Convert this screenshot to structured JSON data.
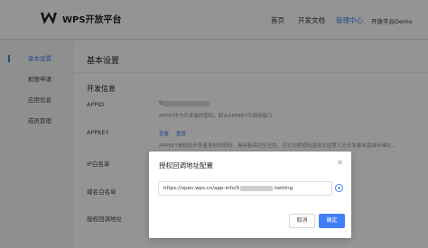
{
  "header": {
    "logo_text": "WPS开放平台",
    "nav": [
      {
        "label": "首页"
      },
      {
        "label": "开发文档"
      },
      {
        "label": "管理中心"
      },
      {
        "label": "开放平台Demo"
      }
    ]
  },
  "sidebar": {
    "items": [
      {
        "label": "基本设置"
      },
      {
        "label": "权限申请"
      },
      {
        "label": "应用信息"
      },
      {
        "label": "成员管理"
      }
    ]
  },
  "main": {
    "title": "基本设置",
    "section_title": "开发信息",
    "appid_label": "APPID",
    "appid_value_prefix": "S",
    "appid_desc": "APPID作为开发者的密码，配合APPKEY可调用接口",
    "appkey_label": "APPKEY",
    "appkey_view": "查看",
    "appkey_reset": "重置",
    "appkey_desc": "APPKEY是校验开发者身份的密码，具有极高的安全性。切记勿把密码直接交给第三方开发者或直接存储在...",
    "ip_whitelist_label": "IP白名单",
    "domain_whitelist_label": "域名白名单",
    "callback_label": "授权回调地址"
  },
  "modal": {
    "title": "授权回调地址配置",
    "input_prefix": "https://open.wps.cn/app-info/S",
    "input_suffix": "/setting",
    "cancel_label": "取消",
    "ok_label": "确定"
  },
  "colors": {
    "accent": "#417ff9"
  }
}
